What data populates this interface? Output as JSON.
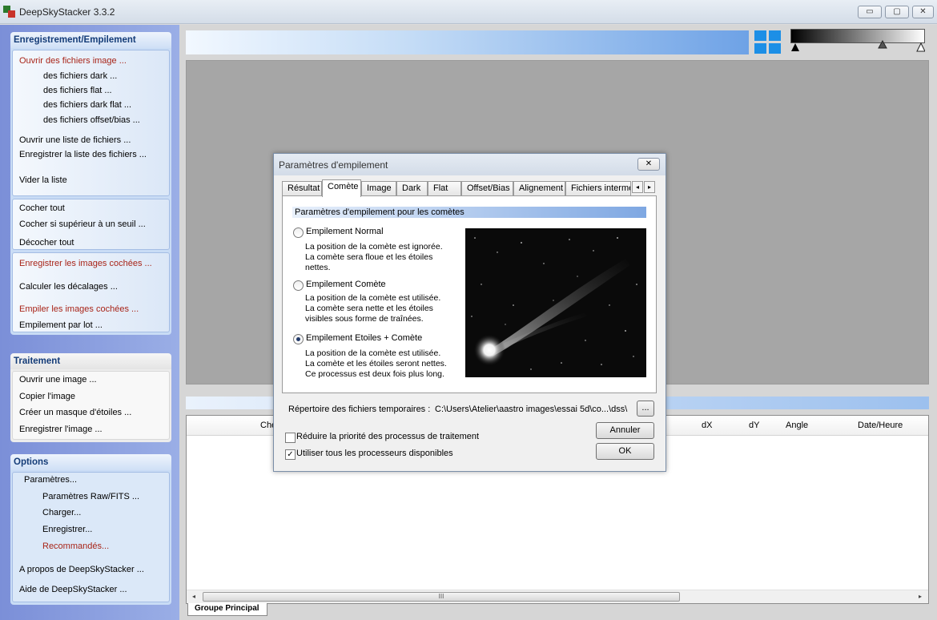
{
  "window": {
    "title": "DeepSkyStacker 3.3.2",
    "controls": {
      "minimize": "▭",
      "maximize": "▢",
      "close": "✕"
    }
  },
  "sidebar": {
    "register": {
      "header": "Enregistrement/Empilement",
      "open_images": "Ouvrir des fichiers image ...",
      "darks": "des fichiers dark ...",
      "flats": "des fichiers flat ...",
      "dark_flats": "des fichiers dark flat ...",
      "offsets": "des fichiers offset/bias ...",
      "open_list": "Ouvrir une liste de fichiers ...",
      "save_list": "Enregistrer la liste des fichiers ...",
      "clear_list": "Vider la liste",
      "check_all": "Cocher tout",
      "check_above": "Cocher si supérieur à un seuil ...",
      "uncheck_all": "Décocher tout",
      "register_checked": "Enregistrer les images cochées ...",
      "compute_offsets": "Calculer les décalages ...",
      "stack_checked": "Empiler les images cochées ...",
      "batch_stacking": "Empilement par lot ..."
    },
    "processing": {
      "header": "Traitement",
      "open_image": "Ouvrir une image ...",
      "copy_image": "Copier l'image",
      "star_mask": "Créer un masque d'étoiles ...",
      "save_image": "Enregistrer l'image ..."
    },
    "options": {
      "header": "Options",
      "settings": "Paramètres...",
      "raw_fits": "Paramètres Raw/FITS ...",
      "load": "Charger...",
      "save": "Enregistrer...",
      "recommended": "Recommandés...",
      "about": "A propos de DeepSkyStacker ...",
      "help": "Aide de DeepSkyStacker ..."
    }
  },
  "file_list": {
    "columns": {
      "path_partial": "Che",
      "dx": "dX",
      "dy": "dY",
      "angle": "Angle",
      "datetime": "Date/Heure"
    },
    "scroll_grip": "III",
    "scroll_left": "◂",
    "scroll_right": "▸",
    "group_tab": "Groupe Principal"
  },
  "dialog": {
    "title": "Paramètres d'empilement",
    "close": "✕",
    "tabs": [
      "Résultat",
      "Comète",
      "Image",
      "Dark",
      "Flat",
      "Offset/Bias",
      "Alignement",
      "Fichiers interméd"
    ],
    "active_tab": "Comète",
    "tab_scroll_left": "◂",
    "tab_scroll_right": "▸",
    "section_title": "Paramètres d'empilement pour les comètes",
    "options": [
      {
        "label": "Empilement Normal",
        "selected": false,
        "desc": [
          "La position de la comète est ignorée.",
          "La comète sera floue et les étoiles",
          "nettes."
        ]
      },
      {
        "label": "Empilement Comète",
        "selected": false,
        "desc": [
          "La position de la comète est utilisée.",
          "La comète sera nette et les étoiles",
          "visibles sous forme de traînées."
        ]
      },
      {
        "label": "Empilement Etoiles + Comète",
        "selected": true,
        "desc": [
          "La position de la comète est utilisée.",
          "La comète et les étoiles seront nettes.",
          "Ce processus est deux fois plus long."
        ]
      }
    ],
    "tempdir_label": "Répertoire des fichiers temporaires :",
    "tempdir_value": "C:\\Users\\Atelier\\aastro images\\essai 5d\\co...\\dss\\",
    "browse_label": "...",
    "reduce_priority": {
      "label": "Réduire la priorité des processus de traitement",
      "checked": false
    },
    "use_all_cpus": {
      "label": "Utiliser tous les processeurs disponibles",
      "checked": true
    },
    "cancel_label": "Annuler",
    "ok_label": "OK"
  }
}
